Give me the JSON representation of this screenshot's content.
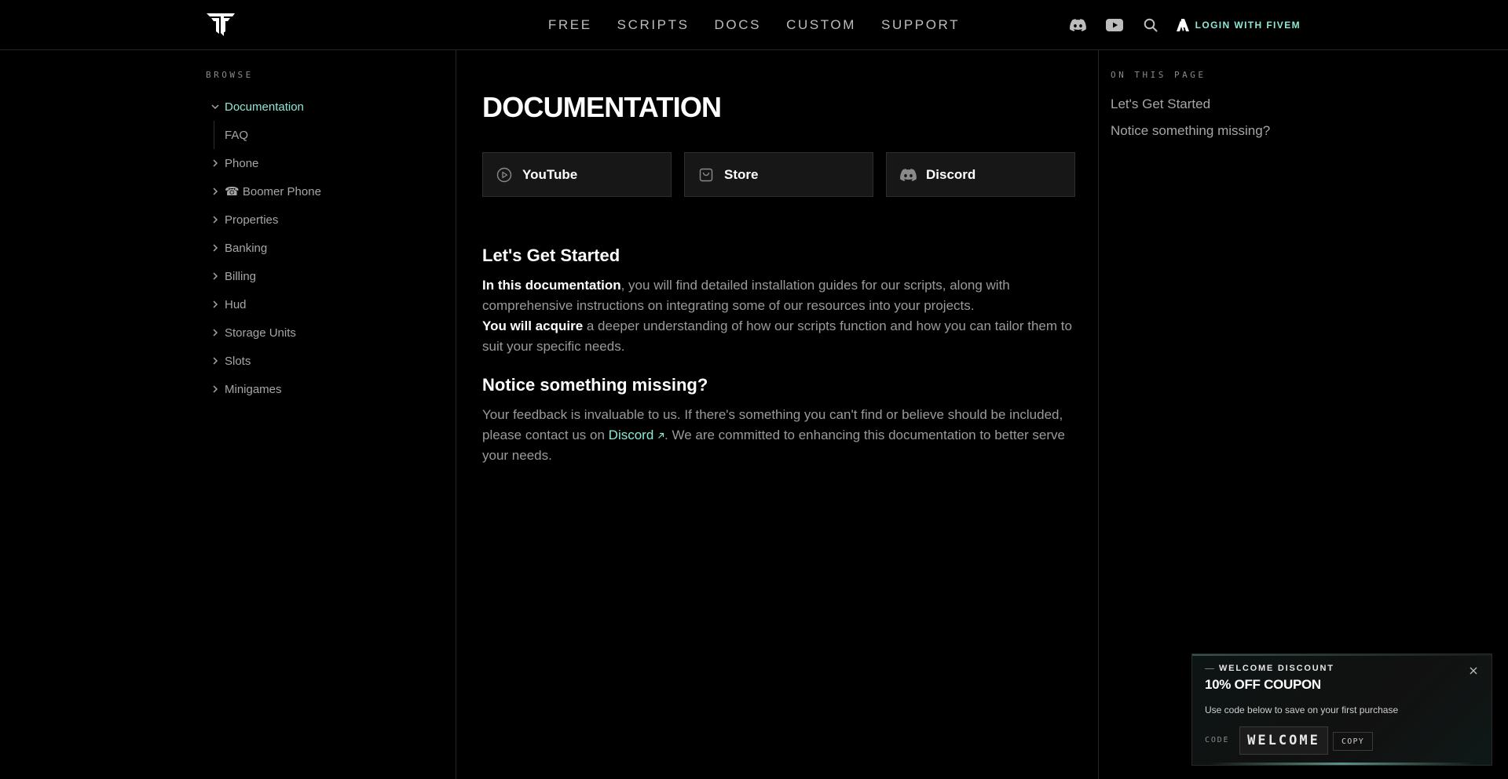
{
  "header": {
    "nav": [
      "FREE",
      "SCRIPTS",
      "DOCS",
      "CUSTOM",
      "SUPPORT"
    ],
    "login_label": "LOGIN WITH FIVEM",
    "icons": [
      "discord-icon",
      "youtube-icon",
      "search-icon",
      "fivem-icon"
    ]
  },
  "sidebar": {
    "section_label": "BROWSE",
    "active_item": "Documentation",
    "sub_items": [
      "FAQ"
    ],
    "items": [
      " Phone",
      "☎ Boomer Phone",
      " Properties",
      " Banking",
      " Billing",
      " Hud",
      " Storage Units",
      " Slots",
      " Minigames"
    ]
  },
  "main": {
    "title": "DOCUMENTATION",
    "cards": [
      "YouTube",
      "Store",
      "Discord"
    ],
    "section1": {
      "heading": "Let's Get Started",
      "p1_bold": "In this documentation",
      "p1_rest": ", you will find detailed installation guides for our scripts, along with comprehensive instructions on integrating some of our resources into your projects.",
      "p2_bold": "You will acquire",
      "p2_rest": " a deeper understanding of how our scripts function and how you can tailor them to suit your specific needs."
    },
    "section2": {
      "heading": "Notice something missing?",
      "p_before": "Your feedback is invaluable to us. If there's something you can't find or believe should be included, please contact us on ",
      "link": "Discord",
      "p_after": ". We are committed to enhancing this documentation to better serve your needs."
    }
  },
  "toc": {
    "label": "ON THIS PAGE",
    "links": [
      "Let's Get Started",
      "Notice something missing?"
    ]
  },
  "coupon": {
    "tag": "WELCOME DISCOUNT",
    "title": "10% OFF COUPON",
    "description": "Use code below to save on your first purchase",
    "code_label": "CODE",
    "code": "WELCOME",
    "copy_label": "COPY"
  },
  "colors": {
    "accent": "#8ee8d4",
    "background": "#000000",
    "muted_text": "#9a9a9a",
    "card_bg": "#171717"
  }
}
